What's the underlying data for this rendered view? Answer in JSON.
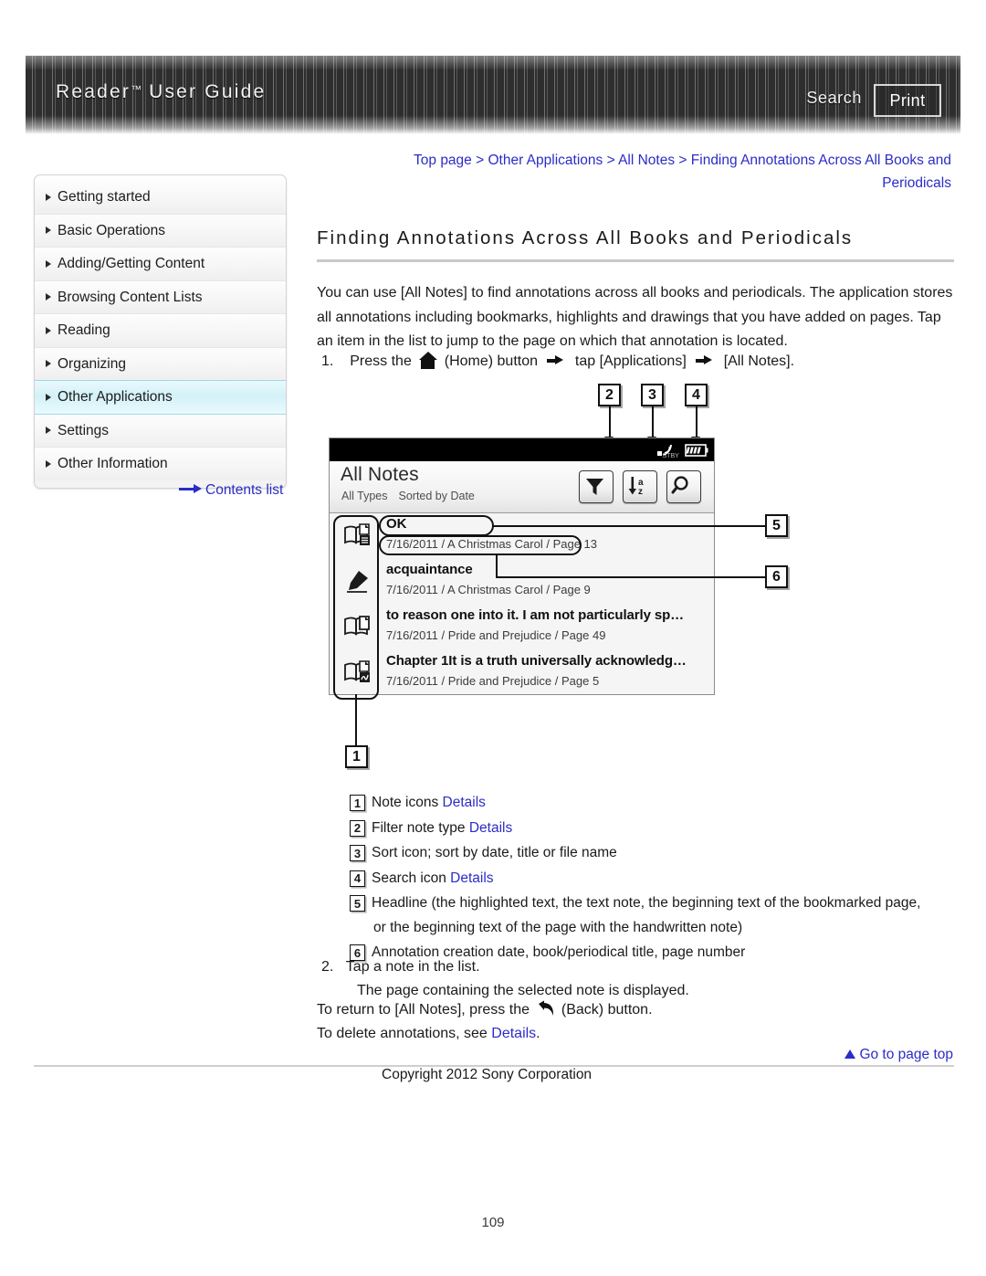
{
  "header": {
    "title_main": "Reader",
    "title_tm": "™",
    "title_rest": " User Guide",
    "search_label": "Search",
    "print_label": "Print"
  },
  "sidebar": {
    "items": [
      {
        "label": "Getting started",
        "active": false
      },
      {
        "label": "Basic Operations",
        "active": false
      },
      {
        "label": "Adding/Getting Content",
        "active": false
      },
      {
        "label": "Browsing Content Lists",
        "active": false
      },
      {
        "label": "Reading",
        "active": false
      },
      {
        "label": "Organizing",
        "active": false
      },
      {
        "label": "Other Applications",
        "active": true
      },
      {
        "label": "Settings",
        "active": false
      },
      {
        "label": "Other Information",
        "active": false
      }
    ],
    "contents_list_label": "Contents list"
  },
  "breadcrumb": {
    "full": "Top page > Other Applications > All Notes > Finding Annotations Across All Books and Periodicals",
    "items": [
      "Top page",
      "Other Applications",
      "All Notes",
      "Finding Annotations Across All Books and Periodicals"
    ],
    "separator": " > "
  },
  "main": {
    "page_title": "Finding Annotations Across All Books and Periodicals",
    "intro_paragraph": "You can use [All Notes] to find annotations across all books and periodicals. The application stores all annotations including bookmarks, highlights and drawings that you have added on pages. Tap an item in the list to jump to the page on which that annotation is located.",
    "step1_number": "1.",
    "step1_before": "Press the",
    "step1_home": "(Home) button",
    "step1_mid": "tap [Applications]",
    "step1_end": "[All Notes].",
    "step2_number": "2.",
    "step2_text": "Tap a note in the list.",
    "step2_sub": "The page containing the selected note is displayed.",
    "closing_line1_a": "To return to [All Notes], press the",
    "closing_line1_b": "(Back) button.",
    "closing_line2_a": "To delete annotations, see",
    "closing_line2_link": "Details",
    "closing_line2_b": ".",
    "go_to_page_top": "Go to page top",
    "copyright": "Copyright 2012 Sony Corporation",
    "page_number": "109"
  },
  "device": {
    "status": {
      "standby_label": "STBY",
      "battery_icon": "battery-icon",
      "wireless_icon": "wireless-standby-icon"
    },
    "screen_title": "All Notes",
    "filter_state": "All Types",
    "sort_state": "Sorted by Date",
    "toolbar": [
      {
        "name": "filter-icon",
        "label": "Filter note type"
      },
      {
        "name": "sort-az-icon",
        "label": "Sort"
      },
      {
        "name": "search-icon",
        "label": "Search"
      }
    ],
    "notes": [
      {
        "icon": "book-text-note-icon",
        "headline": "OK",
        "meta": "7/16/2011 / A Christmas Carol / Page 13"
      },
      {
        "icon": "highlighter-icon",
        "headline": "acquaintance",
        "meta": "7/16/2011 / A Christmas Carol / Page 9"
      },
      {
        "icon": "book-bookmark-icon",
        "headline": "to reason one into it. I am not particularly sp…",
        "meta": "7/16/2011 / Pride and Prejudice / Page 49"
      },
      {
        "icon": "book-handwriting-icon",
        "headline": "Chapter 1It is a truth universally acknowledg…",
        "meta": "7/16/2011 / Pride and Prejudice / Page 5"
      }
    ],
    "callouts": [
      "1",
      "2",
      "3",
      "4",
      "5",
      "6"
    ]
  },
  "legend": [
    {
      "num": "1",
      "text": "Note icons",
      "link": "Details",
      "wrap": ""
    },
    {
      "num": "2",
      "text": "Filter note type",
      "link": "Details",
      "wrap": ""
    },
    {
      "num": "3",
      "text": "Sort icon; sort by date, title or file name",
      "link": "",
      "wrap": ""
    },
    {
      "num": "4",
      "text": "Search icon",
      "link": "Details",
      "wrap": ""
    },
    {
      "num": "5",
      "text": "Headline (the highlighted text, the text note, the beginning text of the bookmarked page,",
      "link": "",
      "wrap": "or the beginning text of the page with the handwritten note)"
    },
    {
      "num": "6",
      "text": "Annotation creation date, book/periodical title, page number",
      "link": "",
      "wrap": ""
    }
  ],
  "colors": {
    "link": "#2c2cc8",
    "active_nav": "#d3f1f8",
    "header_bg": "#2e2e2e"
  }
}
